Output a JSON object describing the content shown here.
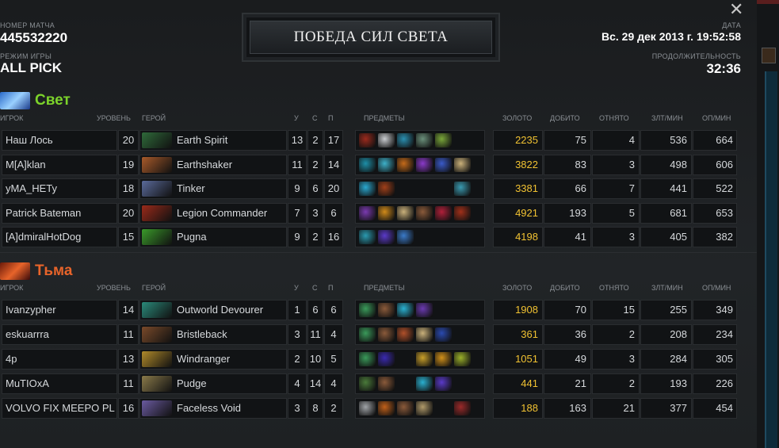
{
  "header": {
    "match_id_label": "НОМЕР МАТЧА",
    "match_id": "445532220",
    "game_mode_label": "РЕЖИМ ИГРЫ",
    "game_mode": "ALL PICK",
    "date_label": "ДАТА",
    "date": "Вс. 29 дек 2013 г. 19:52:58",
    "duration_label": "ПРОДОЛЖИТЕЛЬНОСТЬ",
    "duration": "32:36",
    "victory_banner": "ПОБЕДА СИЛ СВЕТА",
    "close_glyph": "✕"
  },
  "columns": {
    "player": "ИГРОК",
    "level": "УРОВЕНЬ",
    "hero": "ГЕРОЙ",
    "kills": "У",
    "deaths": "С",
    "assists": "П",
    "items": "ПРЕДМЕТЫ",
    "gold": "ЗОЛОТО",
    "last_hits": "ДОБИТО",
    "denies": "ОТНЯТО",
    "gpm": "ЗЛТ/МИН",
    "xpm": "ОП/МИН"
  },
  "radiant": {
    "name": "Свет",
    "color": "#7cd32b",
    "players": [
      {
        "player": "Наш Лось",
        "level": "20",
        "hero": "Earth Spirit",
        "k": "13",
        "d": "2",
        "a": "17",
        "gold": "2235",
        "lh": "75",
        "dn": "4",
        "gpm": "536",
        "xpm": "664",
        "hero_color": "#2f6a3a",
        "items": [
          "#9b2a1d",
          "#c9ccd0",
          "#2a8fb0",
          "#6a8f7a",
          "#7aa73a"
        ]
      },
      {
        "player": "M[A]klan",
        "level": "19",
        "hero": "Earthshaker",
        "k": "11",
        "d": "2",
        "a": "14",
        "gold": "3822",
        "lh": "83",
        "dn": "3",
        "gpm": "498",
        "xpm": "606",
        "hero_color": "#a85a2a",
        "items": [
          "#1d8fa8",
          "#3db0c9",
          "#c46a1a",
          "#8a3ac9",
          "#3a5ac9",
          "#c9b07a"
        ]
      },
      {
        "player": "yMA_HETy",
        "level": "18",
        "hero": "Tinker",
        "k": "9",
        "d": "6",
        "a": "20",
        "gold": "3381",
        "lh": "66",
        "dn": "7",
        "gpm": "441",
        "xpm": "522",
        "hero_color": "#5a6a9a",
        "items": [
          "#2aa8d0",
          "#a0401a",
          "",
          "",
          "",
          "#3a9ab0"
        ]
      },
      {
        "player": "Patrick Bateman",
        "level": "20",
        "hero": "Legion Commander",
        "k": "7",
        "d": "3",
        "a": "6",
        "gold": "4921",
        "lh": "193",
        "dn": "5",
        "gpm": "681",
        "xpm": "653",
        "hero_color": "#9a2a1a",
        "items": [
          "#7a3ab0",
          "#d08a1a",
          "#c9b07a",
          "#8a5a3a",
          "#b0203a",
          "#a0301a"
        ]
      },
      {
        "player": "[A]dmiralHotDog",
        "level": "15",
        "hero": "Pugna",
        "k": "9",
        "d": "2",
        "a": "16",
        "gold": "4198",
        "lh": "41",
        "dn": "3",
        "gpm": "405",
        "xpm": "382",
        "hero_color": "#3a9a2a",
        "items": [
          "#2a9ab0",
          "#5a3ac9",
          "#3a7ac9",
          "",
          "",
          ""
        ]
      }
    ]
  },
  "dire": {
    "name": "Тьма",
    "color": "#e8642a",
    "players": [
      {
        "player": "Ivanzypher",
        "level": "14",
        "hero": "Outworld Devourer",
        "k": "1",
        "d": "6",
        "a": "6",
        "gold": "1908",
        "lh": "70",
        "dn": "15",
        "gpm": "255",
        "xpm": "349",
        "hero_color": "#2a8a7a",
        "items": [
          "#3a9a5a",
          "#8a5a3a",
          "#2ab0d0",
          "#6a3ab0",
          "",
          ""
        ]
      },
      {
        "player": "eskuarrra",
        "level": "11",
        "hero": "Bristleback",
        "k": "3",
        "d": "11",
        "a": "4",
        "gold": "361",
        "lh": "36",
        "dn": "2",
        "gpm": "208",
        "xpm": "234",
        "hero_color": "#7a4a2a",
        "items": [
          "#3a9a5a",
          "#8a5a3a",
          "#b0502a",
          "#c9b07a",
          "#2a4ab0",
          ""
        ]
      },
      {
        "player": "4p",
        "level": "13",
        "hero": "Windranger",
        "k": "2",
        "d": "10",
        "a": "5",
        "gold": "1051",
        "lh": "49",
        "dn": "3",
        "gpm": "284",
        "xpm": "305",
        "hero_color": "#b08a2a",
        "items": [
          "#3a9a5a",
          "#3a2ab0",
          "",
          "#c9a02a",
          "#d0901a",
          "#9ab02a"
        ]
      },
      {
        "player": "MuTIOxA",
        "level": "11",
        "hero": "Pudge",
        "k": "4",
        "d": "14",
        "a": "4",
        "gold": "441",
        "lh": "21",
        "dn": "2",
        "gpm": "193",
        "xpm": "226",
        "hero_color": "#8a7a4a",
        "items": [
          "#4a7a3a",
          "#8a5a3a",
          "",
          "#2ab0d0",
          "#5a3ac9",
          ""
        ]
      },
      {
        "player": "VOLVO FIX MEEPO PL",
        "level": "16",
        "hero": "Faceless Void",
        "k": "3",
        "d": "8",
        "a": "2",
        "gold": "188",
        "lh": "163",
        "dn": "21",
        "gpm": "377",
        "xpm": "454",
        "hero_color": "#6a5aa0",
        "items": [
          "#a0a4a8",
          "#c0601a",
          "#8a5a3a",
          "#b09a6a",
          "",
          "#9a2a2a"
        ]
      }
    ]
  }
}
